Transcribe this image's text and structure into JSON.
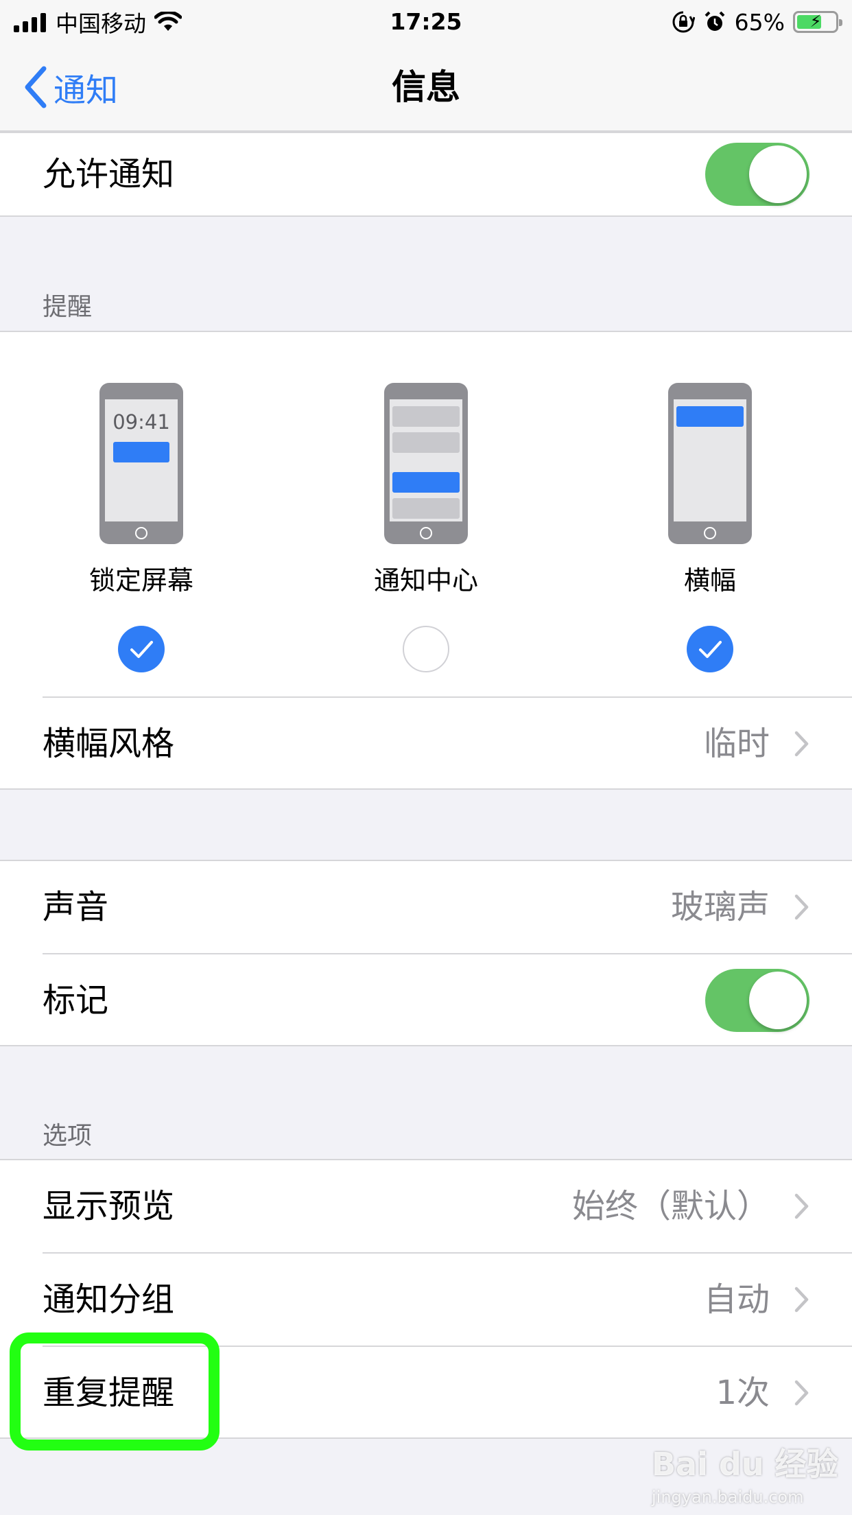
{
  "status_bar": {
    "carrier": "中国移动",
    "time": "17:25",
    "battery_percent": "65%",
    "battery_level": 0.65,
    "icons": [
      "signal-icon",
      "wifi-icon",
      "orientation-lock-icon",
      "alarm-icon",
      "battery-charging-icon"
    ]
  },
  "nav": {
    "back_label": "通知",
    "title": "信息"
  },
  "allow_notifications": {
    "label": "允许通知",
    "enabled": true
  },
  "alerts": {
    "header": "提醒",
    "options": [
      {
        "label": "锁定屏幕",
        "preview_time": "09:41",
        "checked": true
      },
      {
        "label": "通知中心",
        "checked": false
      },
      {
        "label": "横幅",
        "checked": true
      }
    ],
    "banner_style": {
      "label": "横幅风格",
      "value": "临时"
    }
  },
  "sounds": {
    "label": "声音",
    "value": "玻璃声"
  },
  "badges": {
    "label": "标记",
    "enabled": true
  },
  "options": {
    "header": "选项",
    "show_previews": {
      "label": "显示预览",
      "value": "始终（默认）"
    },
    "grouping": {
      "label": "通知分组",
      "value": "自动"
    },
    "repeat_alerts": {
      "label": "重复提醒",
      "value": "1次"
    }
  },
  "watermark": {
    "main": "Bai du 经验",
    "sub": "jingyan.baidu.com"
  },
  "colors": {
    "accent": "#2f7df6",
    "toggle_on": "#64c466",
    "highlight": "#22ff12",
    "background": "#f2f2f7"
  }
}
